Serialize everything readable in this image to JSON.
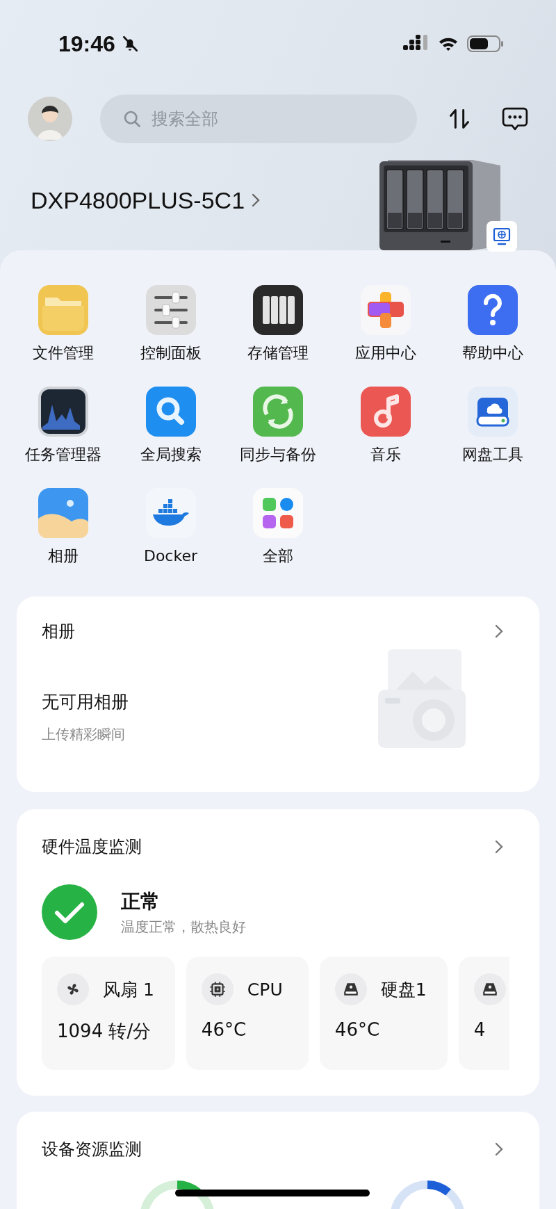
{
  "status_bar": {
    "time": "19:46"
  },
  "header": {
    "search": {
      "placeholder": "搜索全部"
    }
  },
  "device": {
    "name": "DXP4800PLUS-5C1"
  },
  "apps": [
    {
      "label": "文件管理",
      "kind": "folder"
    },
    {
      "label": "控制面板",
      "kind": "sliders"
    },
    {
      "label": "存储管理",
      "kind": "storage"
    },
    {
      "label": "应用中心",
      "kind": "appcenter"
    },
    {
      "label": "帮助中心",
      "kind": "help"
    },
    {
      "label": "任务管理器",
      "kind": "monitor"
    },
    {
      "label": "全局搜索",
      "kind": "search"
    },
    {
      "label": "同步与备份",
      "kind": "sync"
    },
    {
      "label": "音乐",
      "kind": "music"
    },
    {
      "label": "网盘工具",
      "kind": "clouddrive"
    },
    {
      "label": "相册",
      "kind": "photos"
    },
    {
      "label": "Docker",
      "kind": "docker"
    },
    {
      "label": "全部",
      "kind": "all"
    }
  ],
  "album_card": {
    "title": "相册",
    "empty_title": "无可用相册",
    "empty_subtitle": "上传精彩瞬间"
  },
  "hardware_card": {
    "title": "硬件温度监测",
    "status": {
      "kind": "ok",
      "title": "正常",
      "subtitle": "温度正常，散热良好"
    },
    "sensors": [
      {
        "kind": "fan",
        "name": "风扇 1",
        "value": "1094 转/分"
      },
      {
        "kind": "cpu",
        "name": "CPU",
        "value": "46°C"
      },
      {
        "kind": "disk",
        "name": "硬盘1",
        "value": "46°C"
      },
      {
        "kind": "disk",
        "value": "4"
      }
    ]
  },
  "resource_card": {
    "title": "设备资源监测"
  }
}
